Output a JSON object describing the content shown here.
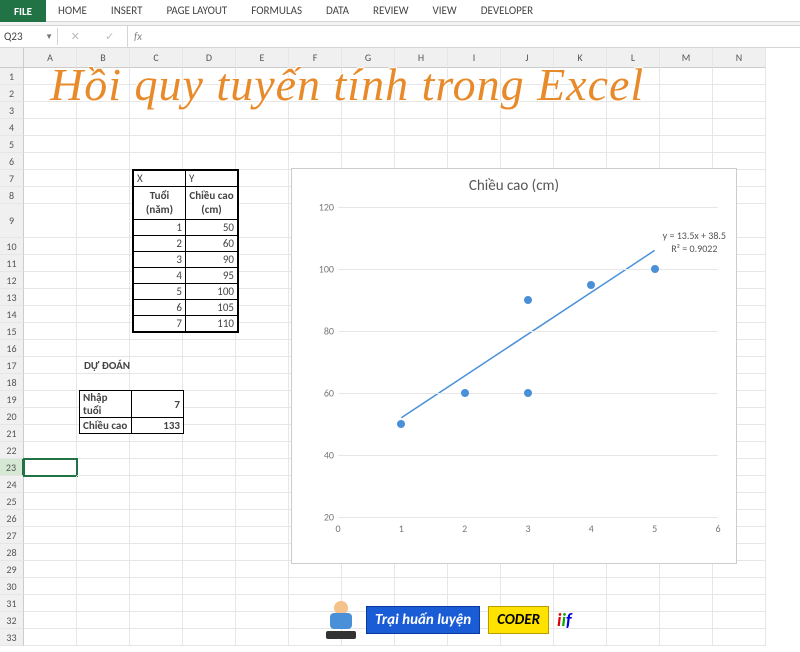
{
  "ribbon": {
    "tabs": [
      "FILE",
      "HOME",
      "INSERT",
      "PAGE LAYOUT",
      "FORMULAS",
      "DATA",
      "REVIEW",
      "VIEW",
      "DEVELOPER"
    ]
  },
  "namebox": "Q23",
  "fx": "",
  "columns": [
    "A",
    "B",
    "C",
    "D",
    "E",
    "F",
    "G",
    "H",
    "I",
    "J",
    "K",
    "L",
    "M",
    "N"
  ],
  "row_count": 33,
  "tall_row": 9,
  "selected_row": 23,
  "title_overlay": "Hồi quy tuyến tính trong Excel",
  "data_table": {
    "col1_hdr": "X",
    "col2_hdr": "Y",
    "col1_sub": "Tuổi (năm)",
    "col2_sub": "Chiều cao (cm)",
    "rows": [
      {
        "x": "1",
        "y": "50"
      },
      {
        "x": "2",
        "y": "60"
      },
      {
        "x": "3",
        "y": "90"
      },
      {
        "x": "4",
        "y": "95"
      },
      {
        "x": "5",
        "y": "100"
      },
      {
        "x": "6",
        "y": "105"
      },
      {
        "x": "7",
        "y": "110"
      }
    ]
  },
  "predict": {
    "label": "DỰ ĐOÁN",
    "row1_l": "Nhập tuổi",
    "row1_v": "7",
    "row2_l": "Chiều cao",
    "row2_v": "133"
  },
  "chart_data": {
    "type": "scatter",
    "title": "Chiều cao (cm)",
    "xlabel": "",
    "ylabel": "",
    "x_ticks": [
      0,
      1,
      2,
      3,
      4,
      5,
      6
    ],
    "y_ticks": [
      20,
      40,
      60,
      80,
      100,
      120
    ],
    "xlim": [
      0,
      6
    ],
    "ylim": [
      20,
      120
    ],
    "series": [
      {
        "name": "points",
        "x": [
          1,
          2,
          3,
          3,
          4,
          5
        ],
        "y": [
          50,
          60,
          60,
          90,
          95,
          100
        ]
      }
    ],
    "trendline": {
      "x1": 1,
      "y1": 52,
      "x2": 5,
      "y2": 106
    },
    "equation": "y = 13.5x + 38.5",
    "r2": "R² = 0.9022"
  },
  "logos": {
    "blue": "Trại huấn luyện",
    "yellow": "CODER"
  }
}
